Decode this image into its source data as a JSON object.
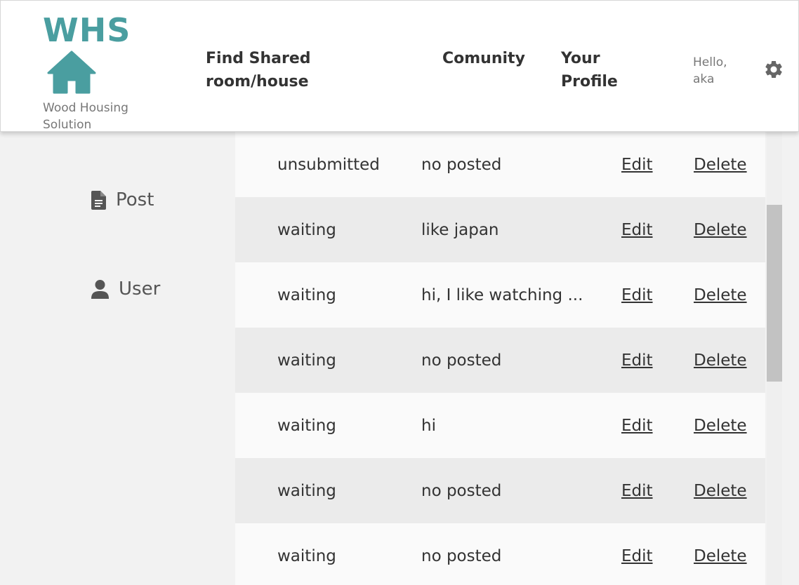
{
  "header": {
    "brand_name": "WHS",
    "brand_tagline": "Wood Housing Solution",
    "nav": {
      "find": "Find Shared room/house",
      "community": "Comunity",
      "profile": "Your Profile"
    },
    "greeting": "Hello, aka",
    "icons": {
      "logo": "house-icon",
      "settings": "gear-icon"
    }
  },
  "sidebar": {
    "items": [
      {
        "label": "Post",
        "icon": "document-icon"
      },
      {
        "label": "User",
        "icon": "person-icon"
      }
    ]
  },
  "table": {
    "rows": [
      {
        "status": "unsubmitted",
        "content": "no posted",
        "edit": "Edit",
        "delete": "Delete"
      },
      {
        "status": "waiting",
        "content": "like japan",
        "edit": "Edit",
        "delete": "Delete"
      },
      {
        "status": "waiting",
        "content": "hi, I like watching ...",
        "edit": "Edit",
        "delete": "Delete"
      },
      {
        "status": "waiting",
        "content": "no posted",
        "edit": "Edit",
        "delete": "Delete"
      },
      {
        "status": "waiting",
        "content": "hi",
        "edit": "Edit",
        "delete": "Delete"
      },
      {
        "status": "waiting",
        "content": "no posted",
        "edit": "Edit",
        "delete": "Delete"
      },
      {
        "status": "waiting",
        "content": "no posted",
        "edit": "Edit",
        "delete": "Delete"
      }
    ]
  },
  "colors": {
    "brand": "#4a9ea0",
    "text": "#333333",
    "muted": "#777777",
    "row_light": "#fafafa",
    "row_dark": "#ebebeb",
    "background": "#f2f2f2"
  }
}
